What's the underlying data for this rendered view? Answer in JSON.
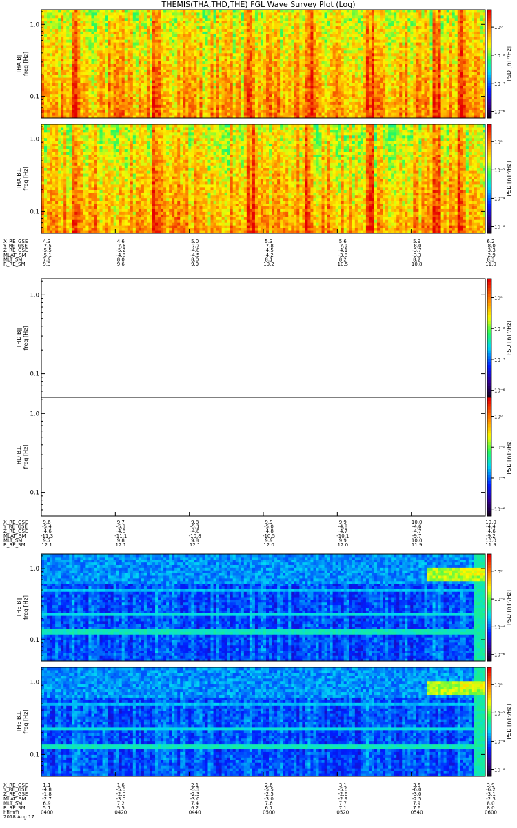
{
  "chart_data": {
    "type": "heatmap",
    "title": "THEMIS(THA,THD,THE) FGL Wave Survey Plot (Log)",
    "colorscale": "rainbow",
    "colorbar_label": "PSD [nT²/Hz]",
    "colorbar_ticks": [
      "10⁰",
      "10⁻²",
      "10⁻⁴",
      "10⁻⁶"
    ],
    "yscale": "log",
    "ylim_hz": [
      0.05,
      1.6
    ],
    "y_ticks": [
      "1.0",
      "0.1"
    ],
    "panels": [
      {
        "probe": "THA",
        "component": "B‖",
        "ylabel": "THA B‖",
        "unit_label": "freq [Hz]",
        "fill": "hot"
      },
      {
        "probe": "THA",
        "component": "B⊥",
        "ylabel": "THA B⊥",
        "unit_label": "freq [Hz]",
        "fill": "hot"
      },
      {
        "probe": "THD",
        "component": "B‖",
        "ylabel": "THD B‖",
        "unit_label": "freq [Hz]",
        "fill": "empty"
      },
      {
        "probe": "THD",
        "component": "B⊥",
        "ylabel": "THD B⊥",
        "unit_label": "freq [Hz]",
        "fill": "empty"
      },
      {
        "probe": "THE",
        "component": "B‖",
        "ylabel": "THE B‖",
        "unit_label": "freq [Hz]",
        "fill": "cool"
      },
      {
        "probe": "THE",
        "component": "B⊥",
        "ylabel": "THE B⊥",
        "unit_label": "freq [Hz]",
        "fill": "cool"
      }
    ],
    "ephemeris": [
      {
        "probe": "THA",
        "rows": [
          {
            "label": "X_RE_GSE",
            "values": [
              "4.3",
              "4.6",
              "5.0",
              "5.3",
              "5.6",
              "5.9",
              "6.2"
            ]
          },
          {
            "label": "Y_RE_GSE",
            "values": [
              "-7.5",
              "-7.6",
              "-7.7",
              "-7.8",
              "-7.9",
              "-8.0",
              "-8.0"
            ]
          },
          {
            "label": "Z_RE_GSE",
            "values": [
              "-5.5",
              "-5.2",
              "-4.8",
              "-4.5",
              "-4.1",
              "-3.7",
              "-3.3"
            ]
          },
          {
            "label": "MLAT_SM",
            "values": [
              "-5.1",
              "-4.8",
              "-4.5",
              "-4.2",
              "-3.8",
              "-3.3",
              "-2.9"
            ]
          },
          {
            "label": "MLT_SM",
            "values": [
              "7.9",
              "8.0",
              "8.0",
              "8.1",
              "8.2",
              "8.2",
              "8.3"
            ]
          },
          {
            "label": "R_RE_SM",
            "values": [
              "9.3",
              "9.6",
              "9.9",
              "10.2",
              "10.5",
              "10.8",
              "11.0"
            ]
          }
        ]
      },
      {
        "probe": "THD",
        "rows": [
          {
            "label": "X_RE_GSE",
            "values": [
              "9.6",
              "9.7",
              "9.8",
              "9.9",
              "9.9",
              "10.0",
              "10.0"
            ]
          },
          {
            "label": "Y_RE_GSE",
            "values": [
              "-5.4",
              "-5.3",
              "-5.1",
              "-5.0",
              "-4.8",
              "-4.6",
              "-4.4"
            ]
          },
          {
            "label": "Z_RE_GSE",
            "values": [
              "-4.6",
              "-4.8",
              "-4.8",
              "-4.8",
              "-4.7",
              "-4.7",
              "-4.6"
            ]
          },
          {
            "label": "MLAT_SM",
            "values": [
              "-11.3",
              "-11.1",
              "-10.8",
              "-10.5",
              "-10.1",
              "-9.7",
              "-9.2"
            ]
          },
          {
            "label": "MLT_SM",
            "values": [
              "9.7",
              "9.8",
              "9.8",
              "9.9",
              "9.9",
              "10.0",
              "10.0"
            ]
          },
          {
            "label": "R_RE_SM",
            "values": [
              "12.1",
              "12.1",
              "12.1",
              "12.0",
              "12.0",
              "11.9",
              "11.9"
            ]
          }
        ]
      },
      {
        "probe": "THE",
        "rows": [
          {
            "label": "X_RE_GSE",
            "values": [
              "1.1",
              "1.6",
              "2.1",
              "2.6",
              "3.1",
              "3.5",
              "3.9"
            ]
          },
          {
            "label": "Y_RE_GSE",
            "values": [
              "-4.8",
              "-5.0",
              "-5.3",
              "-5.5",
              "-5.6",
              "-6.0",
              "-6.2"
            ]
          },
          {
            "label": "Z_RE_GSE",
            "values": [
              "-1.8",
              "-2.0",
              "-2.3",
              "-2.5",
              "-2.6",
              "-3.0",
              "-3.1"
            ]
          },
          {
            "label": "MLAT_SM",
            "values": [
              "-2.7",
              "-3.0",
              "-3.0",
              "-3.0",
              "-2.9",
              "-2.5",
              "-2.3"
            ]
          },
          {
            "label": "MLT_SM",
            "values": [
              "6.9",
              "7.2",
              "7.4",
              "7.6",
              "7.7",
              "7.9",
              "8.0"
            ]
          },
          {
            "label": "R_RE_SM",
            "values": [
              "5.1",
              "5.5",
              "6.2",
              "6.7",
              "7.1",
              "7.6",
              "8.0"
            ]
          }
        ]
      }
    ],
    "time_axis": {
      "label": "hhmm",
      "ticks": [
        "0400",
        "0420",
        "0440",
        "0500",
        "0520",
        "0540",
        "0600"
      ],
      "date": "2018 Aug 17"
    }
  }
}
